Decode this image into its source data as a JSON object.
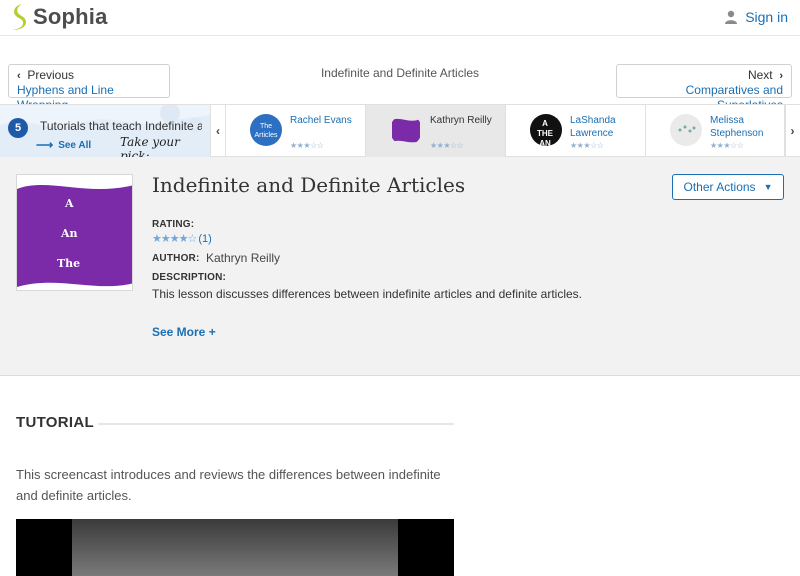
{
  "brand": {
    "name": "Sophia",
    "accent": "#1a6fb4",
    "logo_color": "#b5cf2c"
  },
  "header": {
    "signin_label": "Sign in"
  },
  "nav": {
    "prev": {
      "dir_label": "Previous",
      "title": "Hyphens and Line Wrapping"
    },
    "current_title": "Indefinite and Definite Articles",
    "next": {
      "dir_label": "Next",
      "title": "Comparatives and Superlatives"
    }
  },
  "strip": {
    "count": "5",
    "title": "Tutorials that teach Indefinite and Definite Articles",
    "see_all": "See All",
    "pick": "Take your pick:",
    "tutors": [
      {
        "name_line1": "Rachel Evans",
        "name_line2": "",
        "stars": "★★★☆☆",
        "thumb_text": "The Articles"
      },
      {
        "name_line1": "Kathryn Reilly",
        "name_line2": "",
        "stars": "★★★☆☆",
        "thumb_text": ""
      },
      {
        "name_line1": "LaShanda",
        "name_line2": "Lawrence",
        "stars": "★★★☆☆",
        "thumb_text": "A THE AN"
      },
      {
        "name_line1": "Melissa",
        "name_line2": "Stephenson",
        "stars": "★★★☆☆",
        "thumb_text": ""
      }
    ]
  },
  "lesson": {
    "title": "Indefinite and Definite Articles",
    "other_actions": "Other Actions",
    "cover_words": [
      "A",
      "An",
      "The"
    ],
    "rating_label": "RATING:",
    "rating_stars": "★★★★☆",
    "rating_count": "(1)",
    "author_label": "AUTHOR:",
    "author": "Kathryn Reilly",
    "description_label": "DESCRIPTION:",
    "description": "This lesson discusses differences between indefinite articles and definite articles.",
    "see_more": "See More +"
  },
  "tutorial": {
    "heading": "TUTORIAL",
    "text": "This screencast introduces and reviews the differences between indefinite and definite articles."
  }
}
